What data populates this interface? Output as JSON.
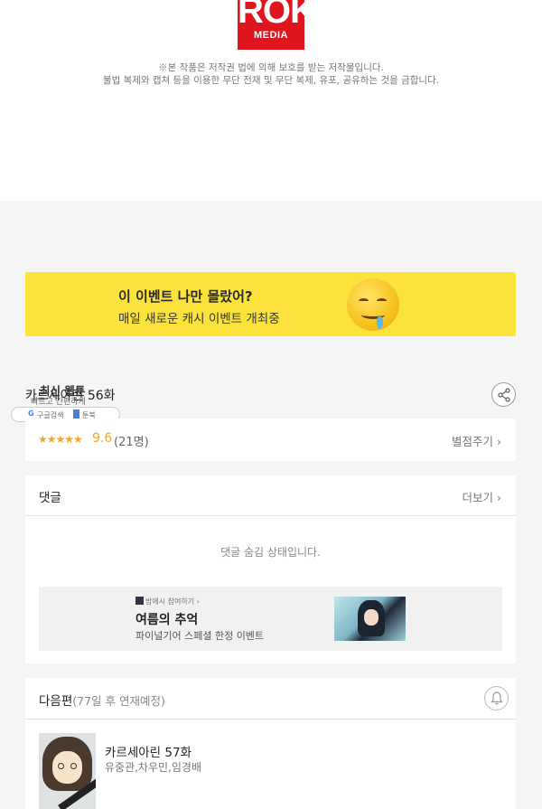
{
  "logo": {
    "big": "ROK",
    "small": "MEDIA"
  },
  "copyright": {
    "line1": "※본 작품은 저작권 법에 의해 보호를 받는 저작물입니다.",
    "line2": "불법 복제와 캡쳐 등을 이용한 무단 전재 및 무단 복제, 유포, 공유하는 것을 금합니다."
  },
  "event_banner": {
    "title": "이 이벤트 나만 몰랐어?",
    "subtitle": "매일 새로운 캐시 이벤트 개최중",
    "emoji_icon": "drooling-face-icon"
  },
  "episode": {
    "title": "카르세아린 56화"
  },
  "overlay_widget": {
    "title": "최신 웹툰",
    "subtitle": "빠르고 간편하게",
    "google_label": "구글검색",
    "book_label": "툰북"
  },
  "rating": {
    "stars": "★★★★★",
    "score": "9.6",
    "count": "(21명)",
    "rate_link": "별점주기"
  },
  "comments": {
    "header": "댓글",
    "more_label": "더보기",
    "hidden_message": "댓글 숨김 상태입니다."
  },
  "ad": {
    "tag": "밤에시 참여하기",
    "title": "여름의 추억",
    "subtitle": "파이널기어 스페셜 한정 이벤트"
  },
  "next_episode": {
    "header": "다음편",
    "schedule": "(77일 후 연재예정)",
    "title": "카르세아린 57화",
    "authors": "유중관,차우민,임경배"
  },
  "colors": {
    "banner": "#fbe33c",
    "star": "#f5a623",
    "logo": "#e0161e"
  }
}
